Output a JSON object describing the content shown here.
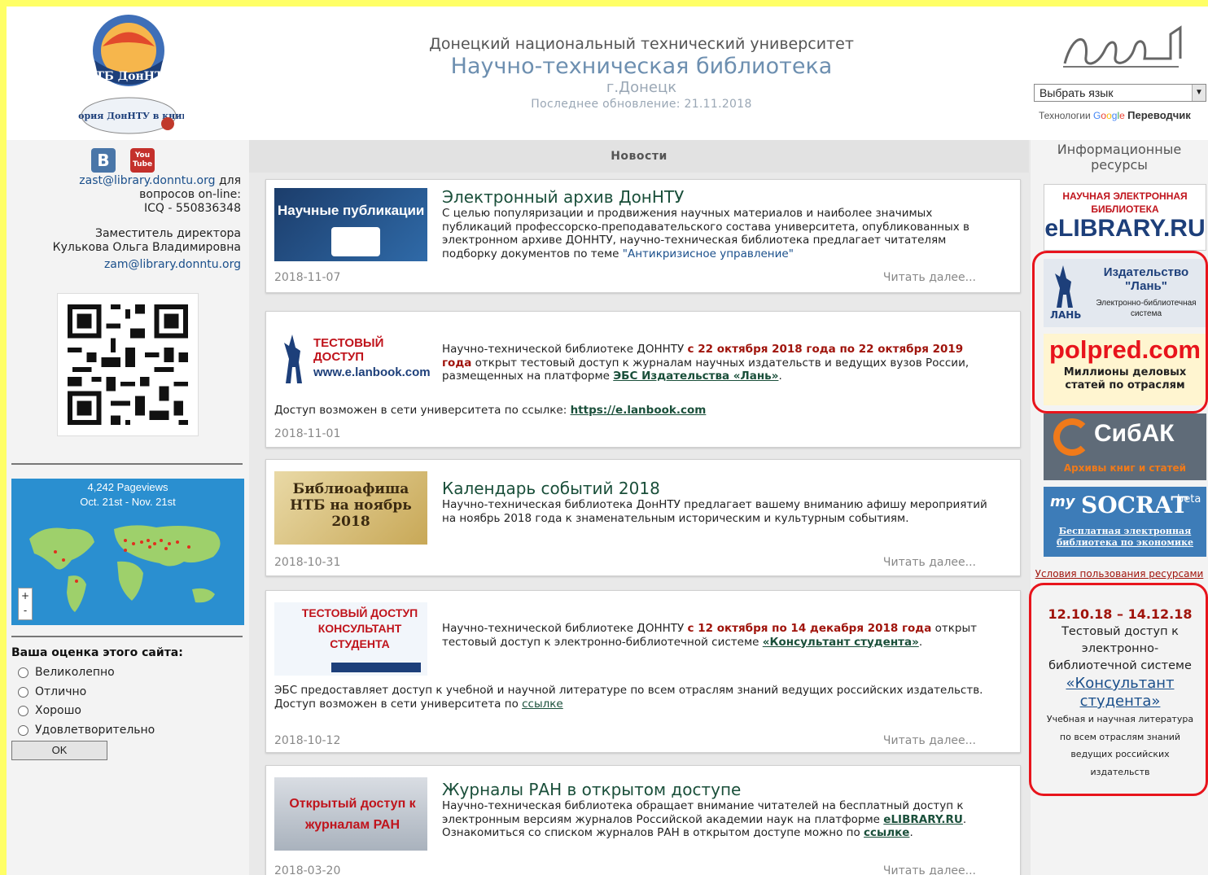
{
  "header": {
    "university": "Донецкий национальный технический университет",
    "library": "Научно-техническая библиотека",
    "city": "г.Донецк",
    "updated": "Последнее обновление: 21.11.2018",
    "logo_text_top": "НТБ ДонНТУ",
    "logo_text_bottom": "История ДонНТУ в книгах",
    "language_select": "Выбрать язык",
    "translate_prefix": "Технологии",
    "translate_suffix": "Переводчик"
  },
  "social": {
    "vk": "B",
    "youtube": "You Tube"
  },
  "columns": {
    "news": "Новости",
    "resources": "Информационные ресурсы"
  },
  "contact": {
    "email1": "zast@library.donntu.org",
    "email1_suffix": "для",
    "line2": "вопросов on-line:",
    "icq": "ICQ - 550836348",
    "deputy_title": "Заместитель директора",
    "deputy_name": "Кулькова Ольга Владимировна",
    "email2": "zam@library.donntu.org"
  },
  "map_widget": {
    "pageviews": "4,242 Pageviews",
    "period": "Oct. 21st - Nov. 21st",
    "zoom_in": "+",
    "zoom_out": "-"
  },
  "poll": {
    "title": "Ваша оценка этого сайта:",
    "options": [
      "Великолепно",
      "Отлично",
      "Хорошо",
      "Удовлетворительно"
    ],
    "submit": "OK"
  },
  "news": [
    {
      "thumb_text": "Научные публикации",
      "title": "Электронный архив ДонНТУ",
      "text": "С целью популяризации и продвижения научных материалов и наиболее значимых публикаций профессорско-преподавательского состава университета, опубликованных в электронном архиве ДОННТУ, научно-техническая библиотека предлагает читателям подборку документов по теме",
      "quote": "\"Антикризисное управление\"",
      "date": "2018-11-07",
      "more": "Читать далее..."
    },
    {
      "thumb_text": "ТЕСТОВЫЙ ДОСТУП",
      "thumb_url": "www.e.lanbook.com",
      "text_a": "Научно-технической библиотеке ДОННТУ",
      "text_b": "с 22 октября 2018 года по 22 октября 2019 года",
      "text_c": "открыт тестовый доступ к журналам научных издательств и ведущих вузов России, размещенных на платформе",
      "link": "ЭБС Издательства «Лань»",
      "access": "Доступ возможен в сети университета по ссылке:",
      "access_link": "https://e.lanbook.com",
      "date": "2018-11-01"
    },
    {
      "thumb_text": "Библиоафиша НТБ на ноябрь 2018",
      "title": "Календарь событий 2018",
      "text": "Научно-техническая библиотека ДонНТУ предлагает вашему вниманию афишу мероприятий на ноябрь 2018 года к знаменательным историческим и культурным событиям.",
      "date": "2018-10-31",
      "more": "Читать далее..."
    },
    {
      "thumb_text": "ТЕСТОВЫЙ ДОСТУП КОНСУЛЬТАНТ СТУДЕНТА",
      "text_a": "Научно-технической библиотеке ДОННТУ",
      "text_b": "с 12 октября по 14 декабря 2018 года",
      "text_c": "открыт тестовый доступ к электронно-библиотечной системе",
      "link": "«Консультант студента»",
      "full1": "ЭБС предоставляет доступ к учебной и научной литературе по всем отраслям знаний ведущих российских издательств.",
      "full2": "Доступ возможен в сети университета по",
      "full2_link": "ссылке",
      "date": "2018-10-12",
      "more": "Читать далее..."
    },
    {
      "thumb_text": "Открытый доступ к журналам РАН",
      "title": "Журналы РАН в открытом доступе",
      "text": "Научно-техническая библиотека обращает внимание читателей на бесплатный доступ к электронным версиям журналов Российской академии наук на платформе",
      "link": "eLIBRARY.RU",
      "text2": "Ознакомиться со списком журналов РАН в открытом доступе можно по",
      "link2": "ссылке",
      "date": "2018-03-20",
      "more": "Читать далее..."
    }
  ],
  "banners": {
    "elib_top": "НАУЧНАЯ ЭЛЕКТРОННАЯ БИБЛИОТЕКА",
    "elib_main": "eLIBRARY.RU",
    "lan_title": "Издательство \"Лань\"",
    "lan_sub": "Электронно-библиотечная система",
    "lan_logo": "ЛАНЬ",
    "pol_main": "polpred.com",
    "pol_sub": "Миллионы деловых статей по отраслям",
    "sib_main": "СибАК",
    "sib_sub": "Архивы книг и статей",
    "soc_main": "SOCRAT",
    "soc_beta": "beta",
    "soc_my": "my",
    "soc_sub": "Бесплатная электронная библиотека по экономике",
    "terms": "Условия пользования ресурсами"
  },
  "promo": {
    "dates": "12.10.18 – 14.12.18",
    "text1": "Тестовый доступ к электронно-библиотечной системе",
    "link": "«Консультант студента»",
    "text2": "Учебная и научная литература по всем отраслям знаний ведущих российских издательств"
  },
  "colors": {
    "accent_red": "#e8141c",
    "title_green": "#1a4f3a",
    "highlight": "#ffff66"
  }
}
